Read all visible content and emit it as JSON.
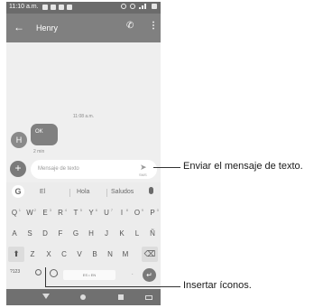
{
  "status_bar": {
    "time": "11:10 a.m."
  },
  "app_bar": {
    "contact_name": "Henry",
    "back_icon": "arrow-left-icon",
    "call_icon": "phone-icon",
    "more_icon": "more-vert-icon"
  },
  "conversation": {
    "time_divider": "11:08 a.m.",
    "avatar_letter": "H",
    "message_text": "OK",
    "message_time": "2 min"
  },
  "compose": {
    "placeholder": "Mensaje de texto",
    "send_label": "SMS"
  },
  "keyboard": {
    "suggestions": [
      "El",
      "Hola",
      "Saludos"
    ],
    "row1": [
      "Q",
      "W",
      "E",
      "R",
      "T",
      "Y",
      "U",
      "I",
      "O",
      "P"
    ],
    "row1_digits": [
      "1",
      "2",
      "3",
      "4",
      "5",
      "6",
      "7",
      "8",
      "9",
      "0"
    ],
    "row2": [
      "A",
      "S",
      "D",
      "F",
      "G",
      "H",
      "J",
      "K",
      "L",
      "Ñ"
    ],
    "row3": [
      "Z",
      "X",
      "C",
      "V",
      "B",
      "N",
      "M"
    ],
    "shift": "⬆",
    "backspace": "⌫",
    "symbols": "?123",
    "comma": ",",
    "period": ".",
    "space_label": "ES • EN",
    "enter": "↵"
  },
  "callouts": {
    "send": "Enviar el mensaje de texto.",
    "emoji": "Insertar íconos."
  }
}
